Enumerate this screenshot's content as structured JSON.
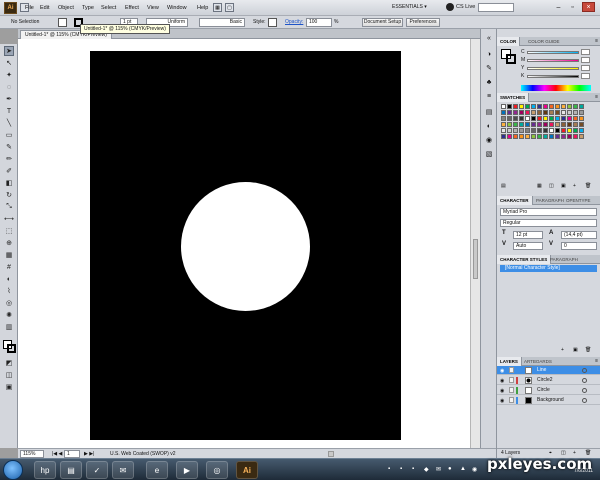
{
  "app": {
    "logo": "Ai",
    "bridge_label": "Br"
  },
  "menubar": {
    "items": [
      "File",
      "Edit",
      "Object",
      "Type",
      "Select",
      "Effect",
      "View",
      "Window",
      "Help"
    ],
    "workspace": "ESSENTIALS ▾",
    "cs_live": "CS Live"
  },
  "controlbar": {
    "selection": "No Selection",
    "stroke_label": "Stroke:",
    "stroke_weight": "1 pt",
    "profile": "Uniform",
    "brush": "Basic",
    "style_label": "Style:",
    "opacity_label": "Opacity:",
    "opacity_value": "100",
    "opacity_unit": "%",
    "document_setup": "Document Setup",
    "preferences": "Preferences"
  },
  "document": {
    "tab_title": "Untitled-1* @ 115% (CMYK/Preview)",
    "tooltip": "Untitled-1* @ 115% (CMYK/Preview)"
  },
  "statusbar": {
    "zoom": "115%",
    "artboard_num": "1",
    "profile": "U.S. Web Coated (SWOP) v2"
  },
  "color_panel": {
    "tabs": [
      "COLOR",
      "COLOR GUIDE"
    ],
    "channels": [
      "C",
      "M",
      "Y",
      "K"
    ]
  },
  "swatches_panel": {
    "tab": "SWATCHES"
  },
  "character_panel": {
    "tabs": [
      "CHARACTER",
      "PARAGRAPH",
      "OPENTYPE"
    ],
    "font": "Myriad Pro",
    "style": "Regular",
    "size": "12 pt",
    "leading": "(14,4 pt)",
    "kerning": "Auto",
    "tracking": "0"
  },
  "character_styles_panel": {
    "tabs": [
      "CHARACTER STYLES",
      "PARAGRAPH"
    ],
    "item": "[Normal Character Style]"
  },
  "layers_panel": {
    "tabs": [
      "LAYERS",
      "ARTBOARDS"
    ],
    "layers": [
      {
        "name": "Line",
        "color": "#3d8ee6"
      },
      {
        "name": "Circle2",
        "color": "#d04040"
      },
      {
        "name": "Circle",
        "color": "#40a040"
      },
      {
        "name": "Background",
        "color": "#3d8ee6"
      }
    ],
    "count": "4 Layers"
  },
  "taskbar": {
    "icons": [
      "ie-icon",
      "hp-icon",
      "explorer-icon",
      "outlook-icon",
      "ie-icon",
      "media-icon",
      "app-icon",
      "illustrator-icon"
    ],
    "ai_label": "Ai",
    "date": "7/6/2011"
  },
  "watermark": "pxleyes.com",
  "colors": {
    "artboard": "#000000",
    "circle": "#ffffff",
    "selection_blue": "#3d8ee6"
  }
}
